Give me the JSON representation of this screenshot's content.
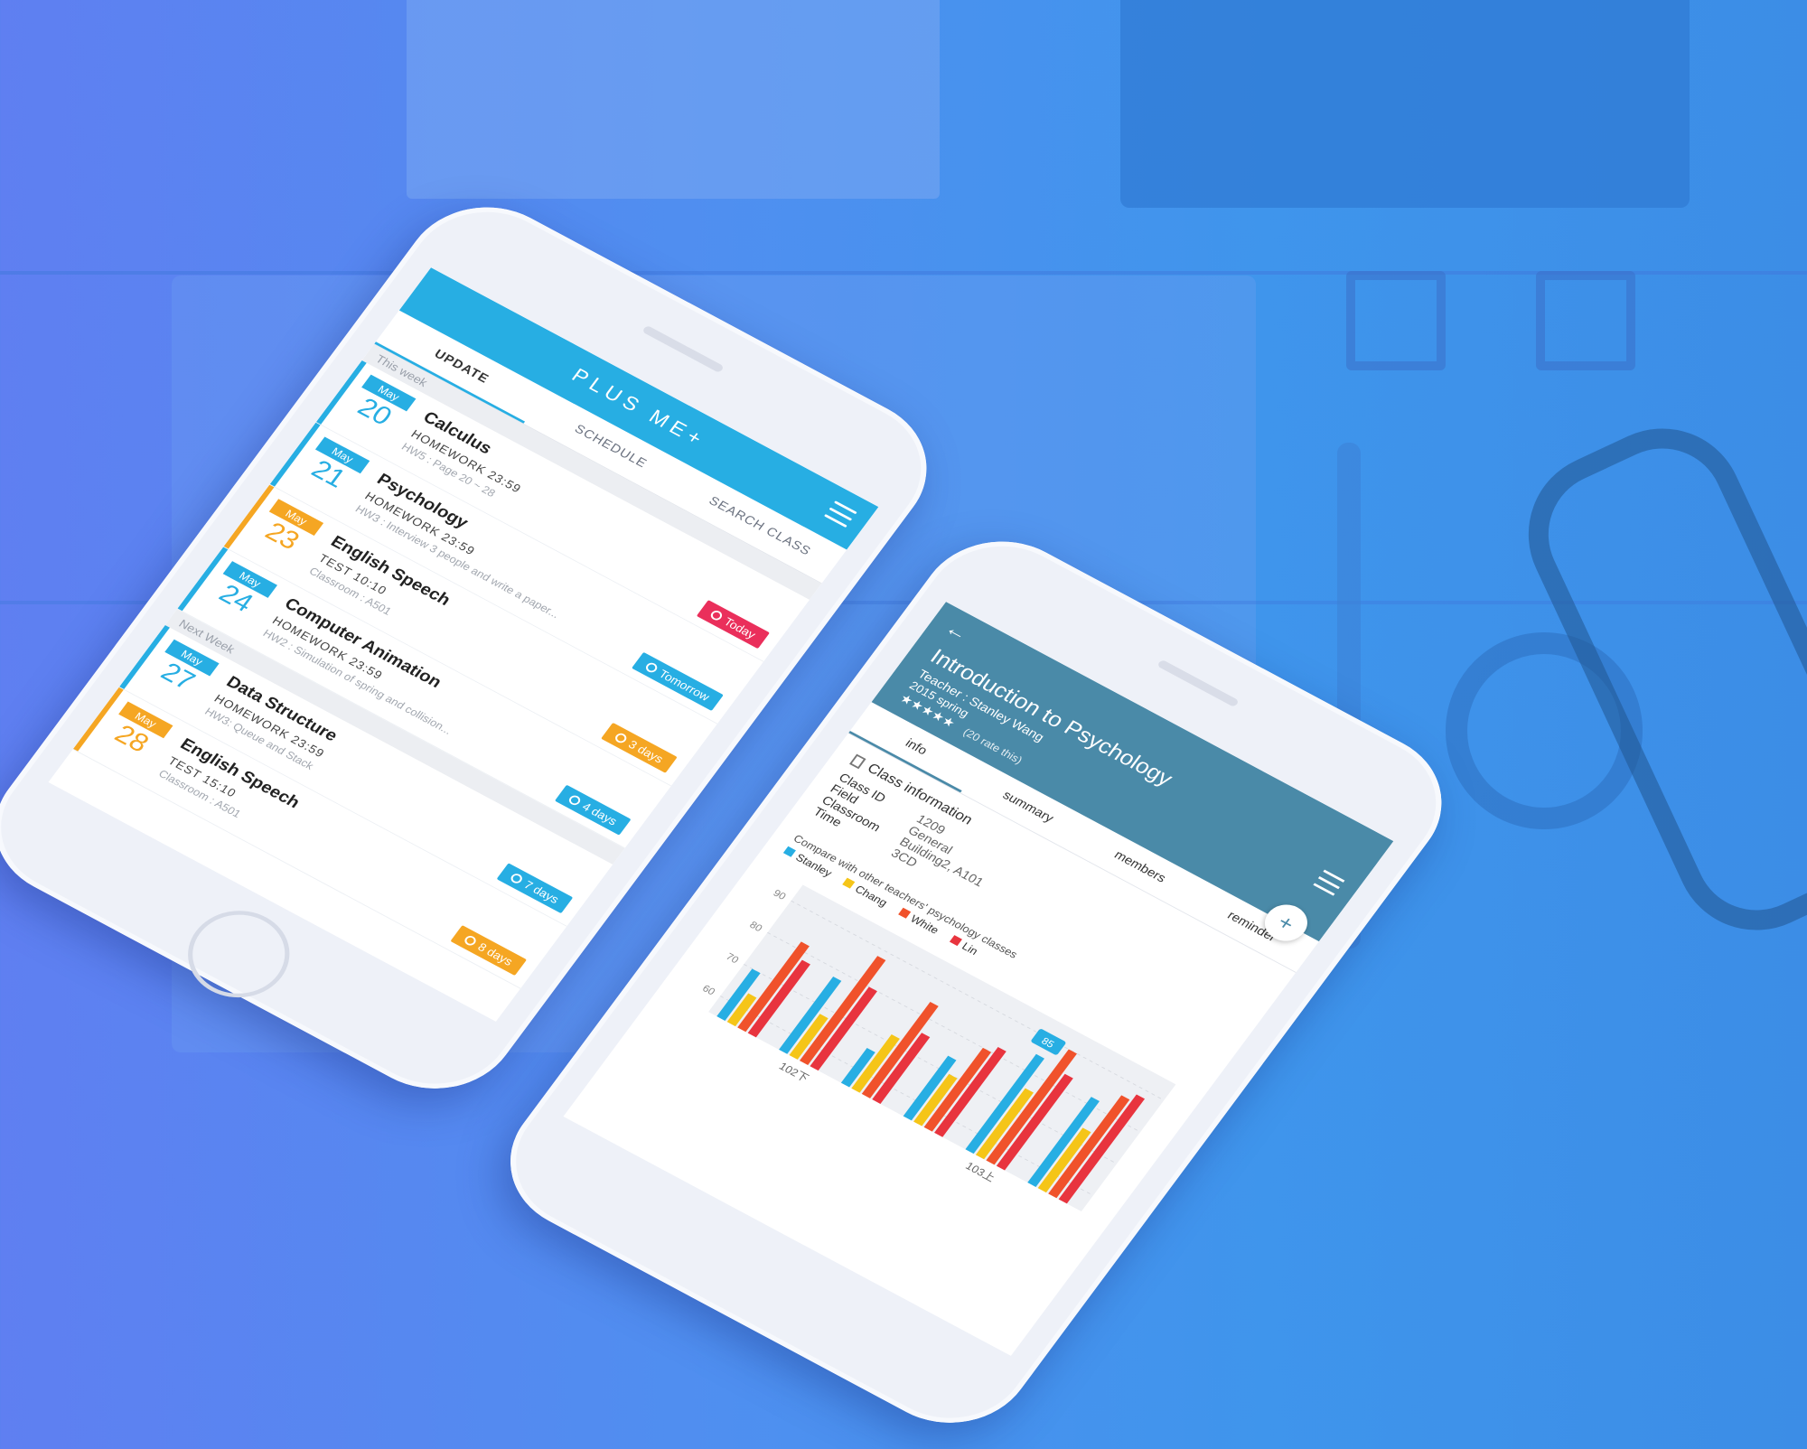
{
  "phone1": {
    "app_title": "PLUS ME+",
    "tabs": [
      "UPDATE",
      "SCHEDULE",
      "SEARCH CLASS"
    ],
    "sections": {
      "this_week": "This week",
      "next_week": "Next Week"
    },
    "items": [
      {
        "month": "May",
        "day": "20",
        "course": "Calculus",
        "type": "HOMEWORK 23:59",
        "desc": "HW5 : Page 20 ~ 28",
        "badge": "Today",
        "color": "#27aee3",
        "badge_color": "#ea2f5b",
        "badge_icon": "clock-icon"
      },
      {
        "month": "May",
        "day": "21",
        "course": "Psychology",
        "type": "HOMEWORK 23:59",
        "desc": "HW3 : Interview 3 people and write a paper...",
        "badge": "Tomorrow",
        "color": "#27aee3",
        "badge_color": "#27aee3",
        "badge_icon": "clock-icon"
      },
      {
        "month": "May",
        "day": "23",
        "course": "English Speech",
        "type": "TEST 10:10",
        "desc": "Classroom : A501",
        "badge": "3 days",
        "color": "#f5a623",
        "badge_color": "#f5a623",
        "badge_icon": "document-icon"
      },
      {
        "month": "May",
        "day": "24",
        "course": "Computer Animation",
        "type": "HOMEWORK 23:59",
        "desc": "HW2 : Simulation of spring and collision...",
        "badge": "4 days",
        "color": "#27aee3",
        "badge_color": "#27aee3",
        "badge_icon": "clock-icon"
      },
      {
        "month": "May",
        "day": "27",
        "course": "Data Structure",
        "type": "HOMEWORK 23:59",
        "desc": "HW3: Queue and Stack",
        "badge": "7 days",
        "color": "#27aee3",
        "badge_color": "#27aee3",
        "badge_icon": "clock-icon"
      },
      {
        "month": "May",
        "day": "28",
        "course": "English Speech",
        "type": "TEST 15:10",
        "desc": "Classroom : A501",
        "badge": "8 days",
        "color": "#f5a623",
        "badge_color": "#f5a623",
        "badge_icon": "document-icon"
      }
    ]
  },
  "phone2": {
    "back": "←",
    "title": "Introduction to Psychology",
    "teacher": "Teacher : Stanley Wang",
    "term": "2015 spring",
    "stars": "★★★★★",
    "rate": "(20 rate this)",
    "tabs": [
      "info",
      "summary",
      "members",
      "reminder"
    ],
    "fab": "+",
    "info_title": "Class information",
    "info_rows": [
      {
        "k": "Class ID",
        "v": "1209"
      },
      {
        "k": "Field",
        "v": "General"
      },
      {
        "k": "Classroom",
        "v": "Building2, A101"
      },
      {
        "k": "Time",
        "v": "3CD"
      }
    ],
    "compare_label": "Compare with other teachers' psychology classes",
    "legend": [
      {
        "name": "Stanley",
        "color": "#27aee3"
      },
      {
        "name": "Chang",
        "color": "#f5c518"
      },
      {
        "name": "White",
        "color": "#f0522b"
      },
      {
        "name": "Lin",
        "color": "#e8343e"
      }
    ],
    "chart_data": {
      "type": "bar",
      "y_ticks": [
        "60",
        "70",
        "80",
        "90"
      ],
      "ylim": [
        55,
        95
      ],
      "categories": [
        "102下",
        "103上"
      ],
      "highlight": "85",
      "series": [
        {
          "name": "Stanley",
          "values": [
            70,
            78,
            66,
            74,
            85,
            82
          ]
        },
        {
          "name": "Chang",
          "values": [
            64,
            68,
            72,
            70,
            76,
            74
          ]
        },
        {
          "name": "White",
          "values": [
            82,
            88,
            84,
            80,
            90,
            86
          ]
        },
        {
          "name": "Lin",
          "values": [
            78,
            80,
            76,
            82,
            84,
            88
          ]
        }
      ]
    }
  }
}
